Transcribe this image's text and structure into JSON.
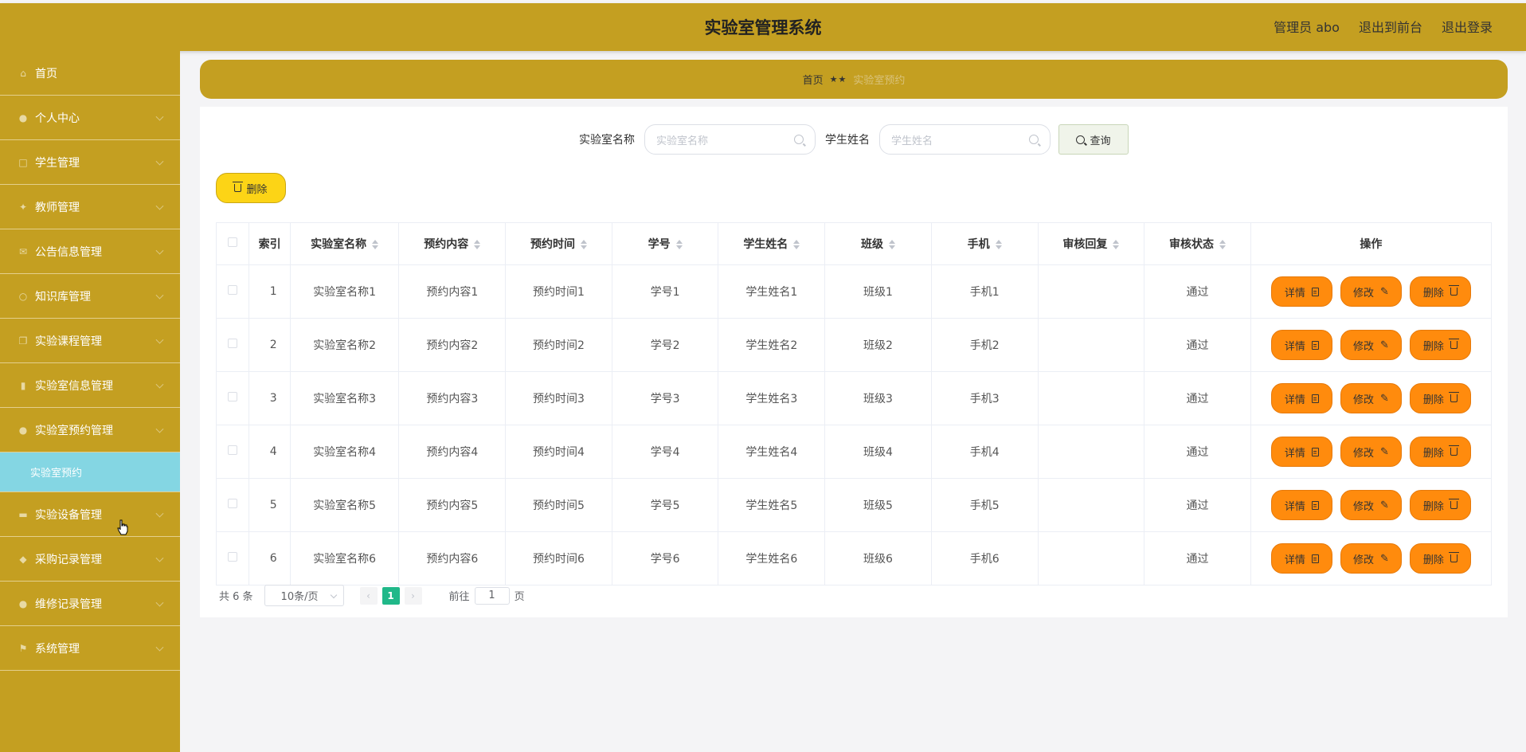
{
  "header": {
    "title": "实验室管理系统",
    "admin_label": "管理员 abo",
    "exit_front_label": "退出到前台",
    "logout_label": "退出登录"
  },
  "sidebar": {
    "items": [
      {
        "label": "首页",
        "icon": "home-icon"
      },
      {
        "label": "个人中心",
        "icon": "user-icon"
      },
      {
        "label": "学生管理",
        "icon": "square-icon"
      },
      {
        "label": "教师管理",
        "icon": "pin-icon"
      },
      {
        "label": "公告信息管理",
        "icon": "mail-icon"
      },
      {
        "label": "知识库管理",
        "icon": "bulb-icon"
      },
      {
        "label": "实验课程管理",
        "icon": "copy-icon"
      },
      {
        "label": "实验室信息管理",
        "icon": "chart-icon"
      },
      {
        "label": "实验室预约管理",
        "icon": "user-icon"
      },
      {
        "label": "实验设备管理",
        "icon": "briefcase-icon"
      },
      {
        "label": "采购记录管理",
        "icon": "location-icon"
      },
      {
        "label": "维修记录管理",
        "icon": "user-icon"
      },
      {
        "label": "系统管理",
        "icon": "flag-icon"
      }
    ],
    "submenu_active": "实验室预约"
  },
  "breadcrumb": {
    "home": "首页",
    "separator": "★★",
    "current": "实验室预约"
  },
  "search": {
    "lab_name_label": "实验室名称",
    "lab_name_placeholder": "实验室名称",
    "student_name_label": "学生姓名",
    "student_name_placeholder": "学生姓名",
    "query_label": "查询"
  },
  "toolbar": {
    "delete_label": "删除"
  },
  "table": {
    "columns": [
      "索引",
      "实验室名称",
      "预约内容",
      "预约时间",
      "学号",
      "学生姓名",
      "班级",
      "手机",
      "审核回复",
      "审核状态",
      "操作"
    ],
    "rows": [
      {
        "index": "1",
        "lab_name": "实验室名称1",
        "content": "预约内容1",
        "time": "预约时间1",
        "student_id": "学号1",
        "student_name": "学生姓名1",
        "class": "班级1",
        "phone": "手机1",
        "reply": "",
        "status": "通过"
      },
      {
        "index": "2",
        "lab_name": "实验室名称2",
        "content": "预约内容2",
        "time": "预约时间2",
        "student_id": "学号2",
        "student_name": "学生姓名2",
        "class": "班级2",
        "phone": "手机2",
        "reply": "",
        "status": "通过"
      },
      {
        "index": "3",
        "lab_name": "实验室名称3",
        "content": "预约内容3",
        "time": "预约时间3",
        "student_id": "学号3",
        "student_name": "学生姓名3",
        "class": "班级3",
        "phone": "手机3",
        "reply": "",
        "status": "通过"
      },
      {
        "index": "4",
        "lab_name": "实验室名称4",
        "content": "预约内容4",
        "time": "预约时间4",
        "student_id": "学号4",
        "student_name": "学生姓名4",
        "class": "班级4",
        "phone": "手机4",
        "reply": "",
        "status": "通过"
      },
      {
        "index": "5",
        "lab_name": "实验室名称5",
        "content": "预约内容5",
        "time": "预约时间5",
        "student_id": "学号5",
        "student_name": "学生姓名5",
        "class": "班级5",
        "phone": "手机5",
        "reply": "",
        "status": "通过"
      },
      {
        "index": "6",
        "lab_name": "实验室名称6",
        "content": "预约内容6",
        "time": "预约时间6",
        "student_id": "学号6",
        "student_name": "学生姓名6",
        "class": "班级6",
        "phone": "手机6",
        "reply": "",
        "status": "通过"
      }
    ],
    "actions": {
      "detail": "详情",
      "edit": "修改",
      "delete": "删除"
    }
  },
  "pagination": {
    "total_label": "共 6 条",
    "page_size": "10条/页",
    "current_page": "1",
    "goto_prefix": "前往",
    "goto_value": "1",
    "goto_suffix": "页"
  },
  "colors": {
    "brand": "#c49f21",
    "submenu_active": "#84d6e3",
    "action_button": "#ff8b0d",
    "delete_button": "#fcd416",
    "page_active": "#20b889"
  }
}
